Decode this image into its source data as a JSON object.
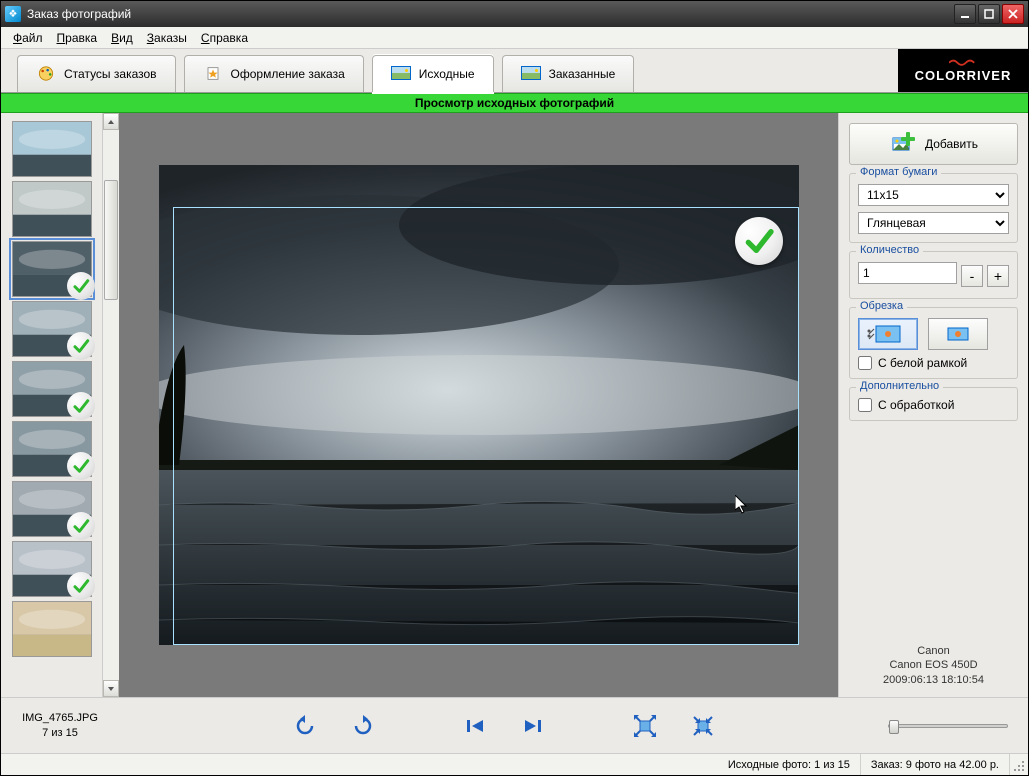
{
  "window": {
    "title": "Заказ фотографий"
  },
  "menu": {
    "file": "Файл",
    "edit": "Правка",
    "view": "Вид",
    "orders": "Заказы",
    "help": "Справка",
    "file_mn": "Ф",
    "edit_mn": "П",
    "view_mn": "В",
    "orders_mn": "З",
    "help_mn": "С"
  },
  "tabs": {
    "statuses": "Статусы заказов",
    "checkout": "Оформление заказа",
    "source": "Исходные",
    "ordered": "Заказанные"
  },
  "brand": "COLORRIVER",
  "viewer_title": "Просмотр исходных фотографий",
  "thumbs": [
    {
      "checked": false
    },
    {
      "checked": false
    },
    {
      "checked": true,
      "selected": true
    },
    {
      "checked": true
    },
    {
      "checked": true
    },
    {
      "checked": true
    },
    {
      "checked": true
    },
    {
      "checked": true
    },
    {
      "checked": false
    }
  ],
  "right": {
    "add": "Добавить",
    "paper_legend": "Формат бумаги",
    "paper_size": "11x15",
    "paper_finish": "Глянцевая",
    "qty_legend": "Количество",
    "qty_value": "1",
    "crop_legend": "Обрезка",
    "white_frame": "С белой рамкой",
    "extra_legend": "Дополнительно",
    "processing": "С обработкой"
  },
  "meta": {
    "make": "Canon",
    "model": "Canon EOS 450D",
    "datetime": "2009:06:13 18:10:54"
  },
  "bottom": {
    "filename": "IMG_4765.JPG",
    "position": "7 из 15"
  },
  "status": {
    "source_count": "Исходные фото:  1 из 15",
    "order_summary": "Заказ: 9 фото на 42.00 р."
  },
  "colors": {
    "green": "#2db82d",
    "blue": "#2060c0"
  }
}
